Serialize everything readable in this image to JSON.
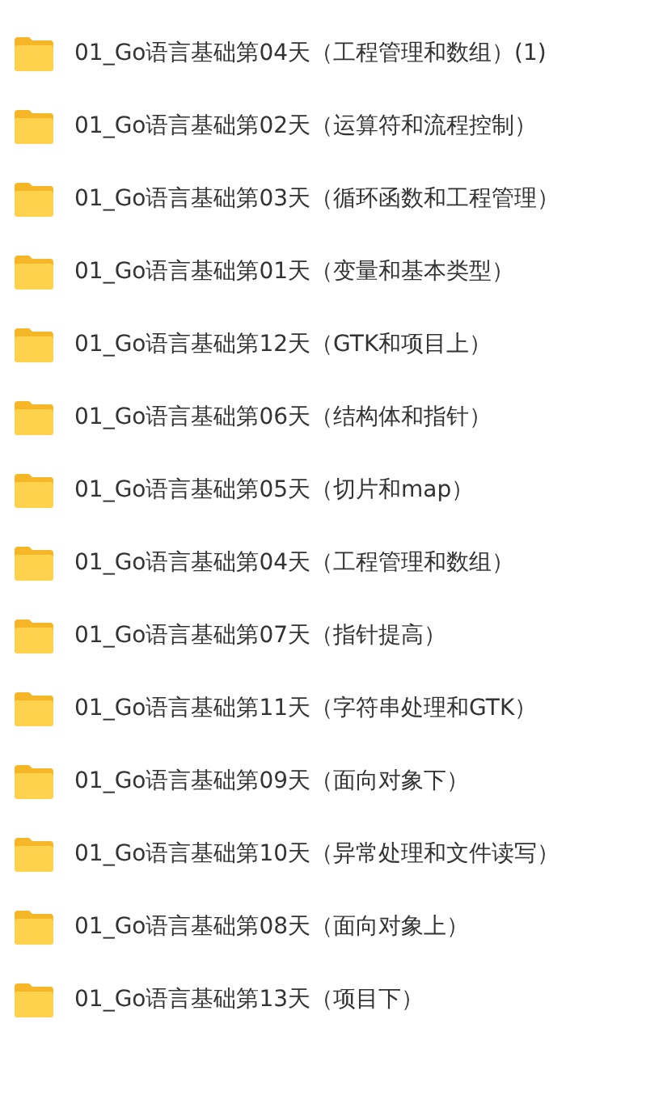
{
  "folders": [
    {
      "name": "01_Go语言基础第04天（工程管理和数组）(1)"
    },
    {
      "name": "01_Go语言基础第02天（运算符和流程控制）"
    },
    {
      "name": "01_Go语言基础第03天（循环函数和工程管理）"
    },
    {
      "name": "01_Go语言基础第01天（变量和基本类型）"
    },
    {
      "name": "01_Go语言基础第12天（GTK和项目上）"
    },
    {
      "name": "01_Go语言基础第06天（结构体和指针）"
    },
    {
      "name": "01_Go语言基础第05天（切片和map）"
    },
    {
      "name": "01_Go语言基础第04天（工程管理和数组）"
    },
    {
      "name": "01_Go语言基础第07天（指针提高）"
    },
    {
      "name": "01_Go语言基础第11天（字符串处理和GTK）"
    },
    {
      "name": "01_Go语言基础第09天（面向对象下）"
    },
    {
      "name": "01_Go语言基础第10天（异常处理和文件读写）"
    },
    {
      "name": "01_Go语言基础第08天（面向对象上）"
    },
    {
      "name": "01_Go语言基础第13天（项目下）"
    }
  ]
}
